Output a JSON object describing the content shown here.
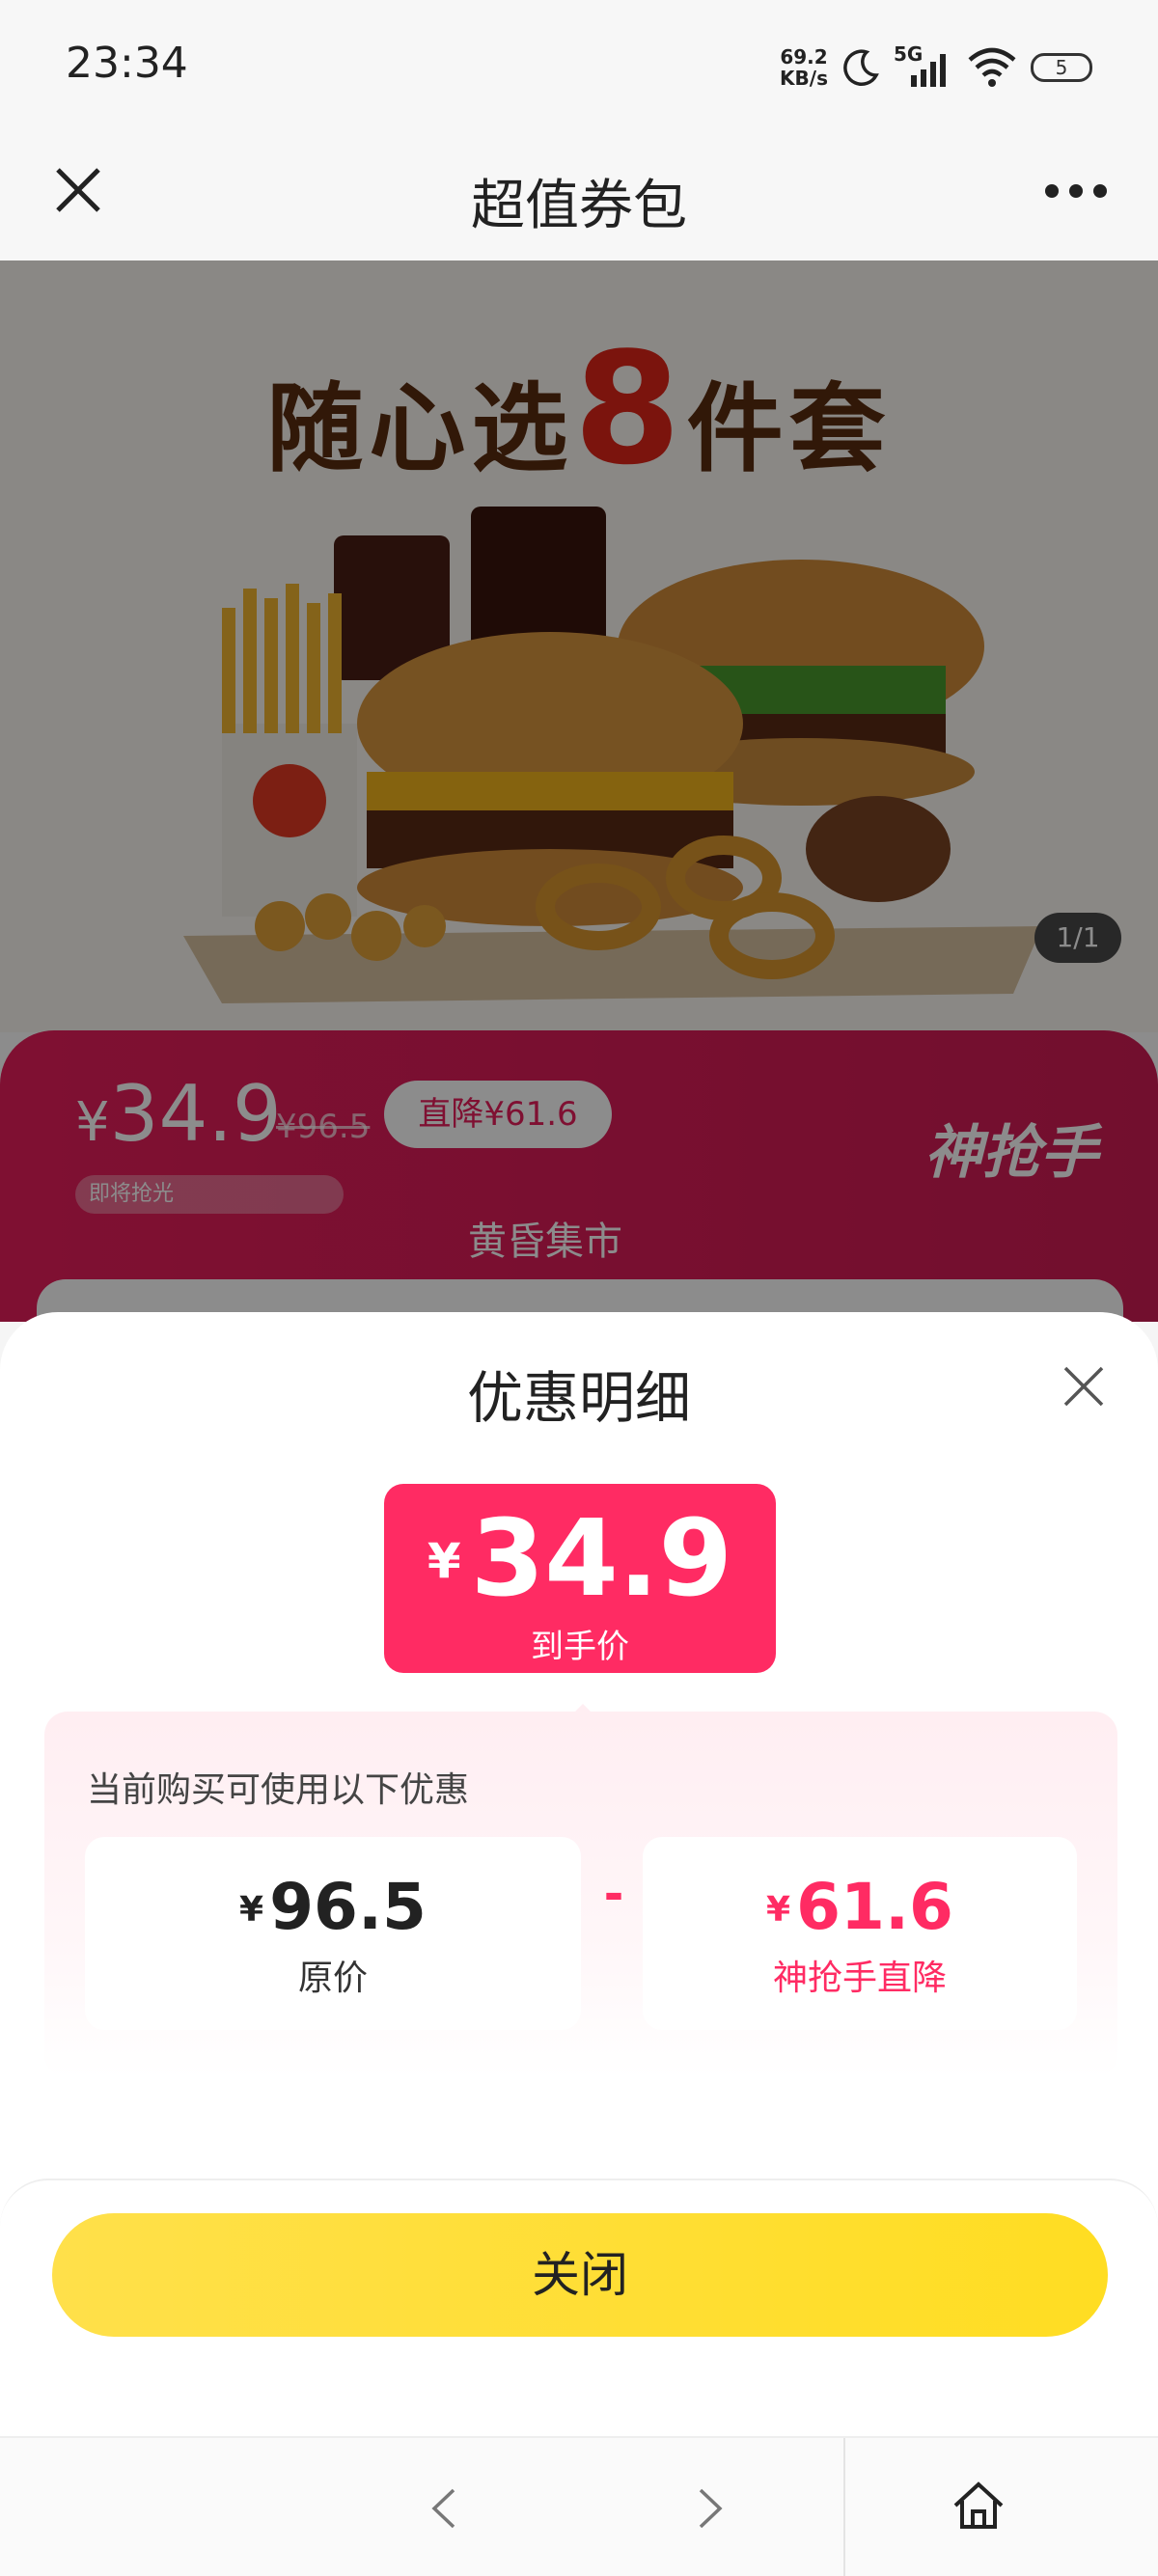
{
  "status_bar": {
    "time": "23:34",
    "net_speed_value": "69.2",
    "net_speed_unit": "KB/s",
    "network": "5G",
    "battery": "5",
    "icons": [
      "moon-icon",
      "signal-icon",
      "wifi-icon",
      "battery-icon"
    ]
  },
  "nav": {
    "title": "超值券包",
    "close_icon": "close-icon",
    "more_icon": "more-icon"
  },
  "hero": {
    "title_prefix": "随心选",
    "title_number": "8",
    "title_suffix": "件套",
    "page_indicator": "1/1"
  },
  "promo": {
    "price_yen": "¥",
    "price": "34.9",
    "original_price": "¥96.5",
    "drop_badge": "直降¥61.6",
    "progress_label": "即将抢光",
    "brand": "神抢手",
    "subtitle": "黄昏集市"
  },
  "sheet": {
    "title": "优惠明细",
    "final_yen": "¥",
    "final_price": "34.9",
    "final_label": "到手价",
    "caption": "当前购买可使用以下优惠",
    "original": {
      "yen": "¥",
      "value": "96.5",
      "label": "原价"
    },
    "operator": "-",
    "discount": {
      "yen": "¥",
      "value": "61.6",
      "label": "神抢手直降"
    },
    "close_button": "关闭"
  },
  "colors": {
    "accent": "#ff2b63",
    "button": "#ffdd22",
    "promo_card": "#e81e5b"
  },
  "bottom_bar": {
    "icons": [
      "back-arrow-icon",
      "forward-arrow-icon",
      "home-icon"
    ]
  }
}
